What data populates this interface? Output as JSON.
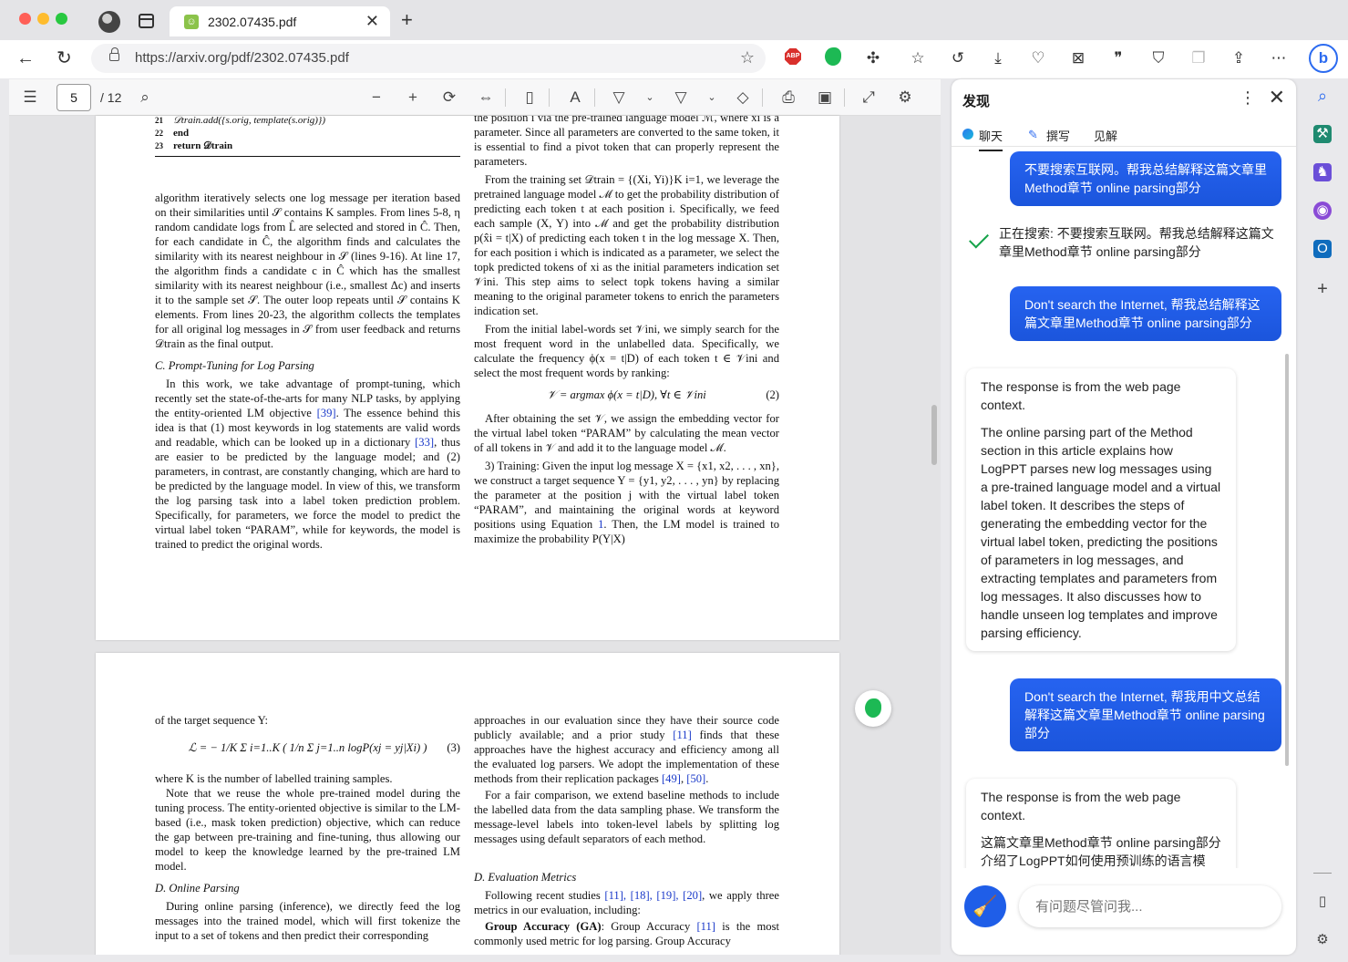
{
  "browser": {
    "tab_title": "2302.07435.pdf",
    "tab_close": "✕",
    "new_tab": "+",
    "url": "https://arxiv.org/pdf/2302.07435.pdf"
  },
  "pdf_toolbar": {
    "page_current": "5",
    "page_total": "/ 12"
  },
  "page1": {
    "algo_lines": [
      {
        "num": "21",
        "text": "𝒟train.add({s.orig, template(s.orig)})"
      },
      {
        "num": "22",
        "text": "end"
      },
      {
        "num": "23",
        "text": "return 𝒟train"
      }
    ],
    "left_p1": "algorithm iteratively selects one log message per iteration based on their similarities until 𝒮 contains K samples. From lines 5-8, η random candidate logs from L̂ are selected and stored in Ĉ. Then, for each candidate in Ĉ, the algorithm finds and calculates the similarity with its nearest neighbour in 𝒮 (lines 9-16). At line 17, the algorithm finds a candidate c in Ĉ which has the smallest similarity with its nearest neighbour (i.e., smallest Δc) and inserts it to the sample set 𝒮. The outer loop repeats until 𝒮 contains K elements. From lines 20-23, the algorithm collects the templates for all original log messages in 𝒮 from user feedback and returns 𝒟train as the final output.",
    "left_sect": "C.  Prompt-Tuning for Log Parsing",
    "left_p2_a": "In this work, we take advantage of prompt-tuning, which recently set the state-of-the-arts for many NLP tasks, by applying the entity-oriented LM objective ",
    "left_p2_ref1": "[39]",
    "left_p2_b": ". The essence behind this idea is that (1) most keywords in log statements are valid words and readable, which can be looked up in a dictionary ",
    "left_p2_ref2": "[33]",
    "left_p2_c": ", thus are easier to be predicted by the language model; and (2) parameters, in contrast, are constantly changing, which are hard to be predicted by the language model. In view of this, we transform the log parsing task into a label token prediction problem. Specifically, for parameters, we force the model to predict the virtual label token “PARAM”, while for keywords, the model is trained to predict the original words.",
    "right_p0": "the position i via the pre-trained language model ℳ, where xi is a parameter. Since all parameters are converted to the same token, it is essential to find a pivot token that can properly represent the parameters.",
    "right_p1": "From the training set 𝒟train = {(Xi, Yi)}K i=1, we leverage the pretrained language model ℳ to get the probability distribution of predicting each token t at each position i. Specifically, we feed each sample (X, Y) into ℳ and get the probability distribution p(x̂i = t|X) of predicting each token t in the log message X. Then, for each position i which is indicated as a parameter, we select the topk predicted tokens of xi as the initial parameters indication set 𝒱ini. This step aims to select topk tokens having a similar meaning to the original parameter tokens to enrich the parameters indication set.",
    "right_p2": "From the initial label-words set 𝒱ini, we simply search for the most frequent word in the unlabelled data. Specifically, we calculate the frequency ϕ(x = t|D) of each token t ∈ 𝒱ini and select the most frequent words by ranking:",
    "right_eq": "𝒱 = argmax ϕ(x = t|D), ∀t ∈ 𝒱ini",
    "right_eq_no": "(2)",
    "right_p3": "After obtaining the set 𝒱, we assign the embedding vector for the virtual label token “PARAM” by calculating the mean vector of all tokens in 𝒱 and add it to the language model ℳ.",
    "right_p4_a": "3) Training:  Given the input log message X = {x1, x2, . . . , xn}, we construct a target sequence Y = {y1, y2, . . . , yn} by replacing the parameter at the position j with the virtual label token “PARAM”, and maintaining the original words at keyword positions using Equation ",
    "right_p4_ref": "1",
    "right_p4_b": ". Then, the LM model is trained to maximize the probability P(Y|X)"
  },
  "page2": {
    "left_p0": "of the target sequence Y:",
    "left_eq": "ℒ = − 1/K Σ i=1..K ( 1/n Σ j=1..n logP(xj = yj|Xi) )",
    "left_eq_no": "(3)",
    "left_p1": "where K is the number of labelled training samples.",
    "left_p2": "Note that we reuse the whole pre-trained model during the tuning process. The entity-oriented objective is similar to the LM-based (i.e., mask token prediction) objective, which can reduce the gap between pre-training and fine-tuning, thus allowing our model to keep the knowledge learned by the pre-trained LM model.",
    "left_sect": "D.  Online Parsing",
    "left_p3": "During online parsing (inference), we directly feed the log messages into the trained model, which will first tokenize the input to a set of tokens and then predict their corresponding",
    "right_p1_a": "approaches in our evaluation since they have their source code publicly available; and a prior study ",
    "right_p1_ref1": "[11]",
    "right_p1_b": " finds that these approaches have the highest accuracy and efficiency among all the evaluated log parsers. We adopt the implementation of these methods from their replication packages ",
    "right_p1_ref2": "[49]",
    "right_p1_c": ", ",
    "right_p1_ref3": "[50]",
    "right_p1_d": ".",
    "right_p2": "For a fair comparison, we extend baseline methods to include the labelled data from the data sampling phase. We transform the message-level labels into token-level labels by splitting log messages using default separators of each method.",
    "right_sect": "D.  Evaluation Metrics",
    "right_p3_a": "Following recent studies ",
    "right_p3_refs": "[11], [18], [19], [20]",
    "right_p3_b": ", we apply three metrics in our evaluation, including:",
    "right_p4_bold": "Group Accuracy (GA)",
    "right_p4_a": ": Group Accuracy ",
    "right_p4_ref": "[11]",
    "right_p4_b": " is the most commonly used metric for log parsing. Group Accuracy"
  },
  "discover": {
    "title": "发现",
    "more": "⋮",
    "close": "✕",
    "tabs": [
      "聊天",
      "撰写",
      "见解"
    ],
    "messages": [
      {
        "role": "user",
        "text": "不要搜索互联网。帮我总结解释这篇文章里Method章节 online parsing部分"
      },
      {
        "role": "status",
        "text": "正在搜索: 不要搜索互联网。帮我总结解释这篇文章里Method章节 online parsing部分"
      },
      {
        "role": "user",
        "text": "Don't search the Internet, 帮我总结解释这篇文章里Method章节 online parsing部分"
      },
      {
        "role": "bot",
        "paras": [
          "The response is from the web page context.",
          "The online parsing part of the Method section in this article explains how LogPPT parses new log messages using a pre-trained language model and a virtual label token. It describes the steps of generating the embedding vector for the virtual label token, predicting the positions of parameters in log messages, and extracting templates and parameters from log messages. It also discusses how to handle unseen log templates and improve parsing efficiency."
        ]
      },
      {
        "role": "user",
        "text": "Don't search the Internet, 帮我用中文总结解释这篇文章里Method章节 online parsing部分"
      },
      {
        "role": "bot",
        "paras": [
          "The response is from the web page context.",
          "这篇文章里Method章节 online parsing部分介绍了LogPPT如何使用预训练的语言模"
        ]
      }
    ],
    "input_placeholder": "有问题尽管问我..."
  },
  "colors": {
    "accent": "#1f5ee8",
    "check": "#16a34a",
    "link": "#1a39c9"
  }
}
